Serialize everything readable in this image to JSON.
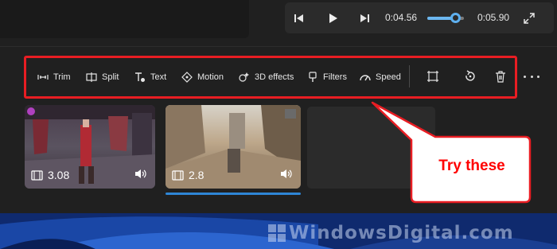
{
  "player": {
    "current_time": "0:04.56",
    "total_time": "0:05.90",
    "progress": 0.77
  },
  "toolbar": {
    "trim": "Trim",
    "split": "Split",
    "text": "Text",
    "motion": "Motion",
    "effects3d": "3D effects",
    "filters": "Filters",
    "speed": "Speed",
    "icons": [
      "trim-icon",
      "split-icon",
      "text-icon",
      "motion-icon",
      "3d-effects-icon",
      "filters-icon",
      "speed-icon",
      "resize-icon",
      "rotate-icon",
      "delete-icon",
      "more-icon"
    ]
  },
  "clips": [
    {
      "duration": "3.08",
      "selected": false
    },
    {
      "duration": "2.8",
      "selected": true
    }
  ],
  "callout": {
    "text": "Try these"
  },
  "watermark": {
    "text": "WindowsDigital.com"
  },
  "colors": {
    "annotation_red": "#e81d23",
    "accent_blue": "#5eb0ef",
    "background": "#202020"
  }
}
